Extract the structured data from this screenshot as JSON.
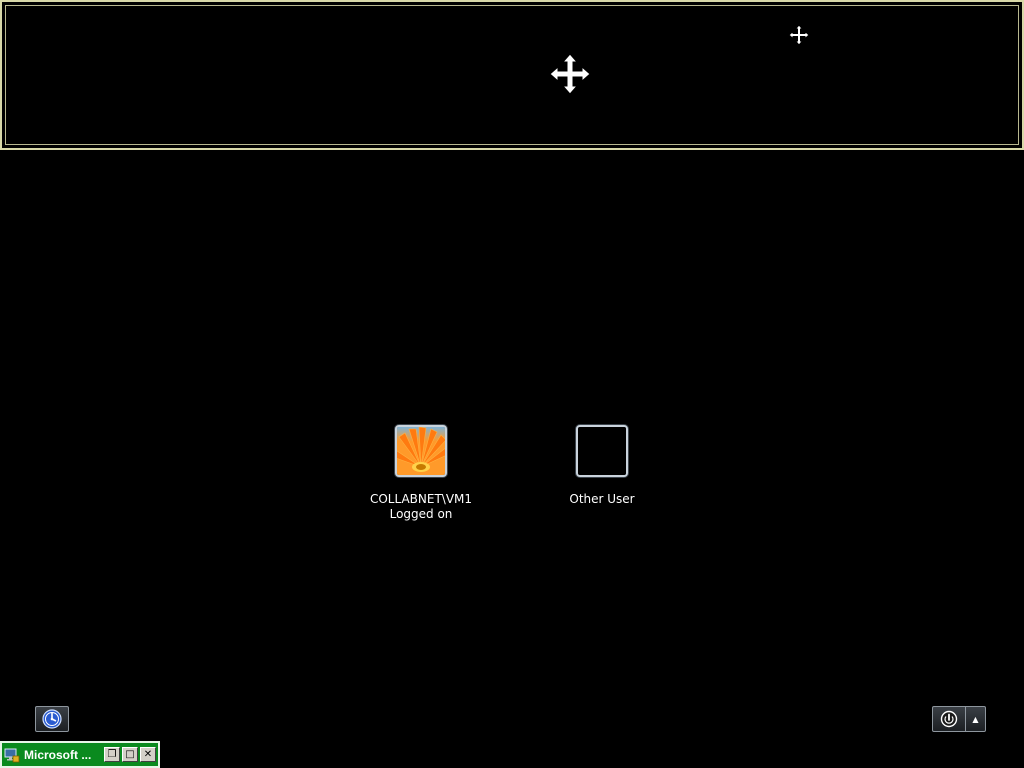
{
  "users": [
    {
      "name": "COLLABNET\\VM1",
      "status": "Logged on",
      "avatar": "orange-gerbera-flower"
    },
    {
      "name": "Other User",
      "status": "",
      "avatar": "empty"
    }
  ],
  "icons": {
    "move_cursor": "move-arrows-icon",
    "ease_of_access": "ease-of-access-icon",
    "shutdown": "power-icon",
    "shutdown_options": "arrow-up-icon",
    "session_app": "remote-desktop-icon"
  },
  "session_bar": {
    "title": "Microsoft ...",
    "restore_glyph": "❐",
    "maximize_glyph": "□",
    "close_glyph": "✕"
  },
  "shutdown_arrow_glyph": "▲",
  "colors": {
    "background": "#000000",
    "frame_border": "#d8d8a8",
    "session_bar": "#0a8a1e"
  }
}
